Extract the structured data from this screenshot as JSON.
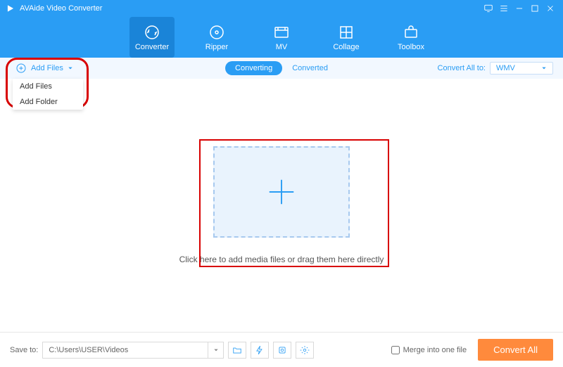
{
  "title": "AVAide Video Converter",
  "nav": {
    "converter": "Converter",
    "ripper": "Ripper",
    "mv": "MV",
    "collage": "Collage",
    "toolbox": "Toolbox"
  },
  "toolbar": {
    "add_files": "Add Files",
    "converting": "Converting",
    "converted": "Converted",
    "convert_all_to": "Convert All to:",
    "format": "WMV"
  },
  "dropdown": {
    "add_files": "Add Files",
    "add_folder": "Add Folder"
  },
  "drop_text": "Click here to add media files or drag them here directly",
  "footer": {
    "save_to": "Save to:",
    "path": "C:\\Users\\USER\\Videos",
    "merge": "Merge into one file",
    "convert_all": "Convert All"
  }
}
